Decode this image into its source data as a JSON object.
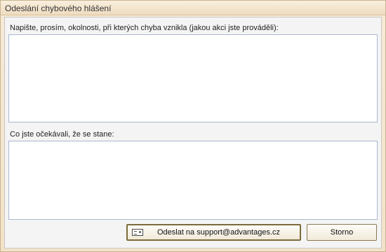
{
  "window": {
    "title": "Odeslání chybového hlášení"
  },
  "form": {
    "circumstances_label": "Napište, prosím, okolnosti, při kterých chyba vznikla (jakou akci jste prováděli):",
    "circumstances_value": "",
    "expected_label": "Co jste očekávali, že se stane:",
    "expected_value": ""
  },
  "buttons": {
    "send_label": "Odeslat na support@advantages.cz",
    "send_icon": "mail-icon",
    "cancel_label": "Storno"
  }
}
